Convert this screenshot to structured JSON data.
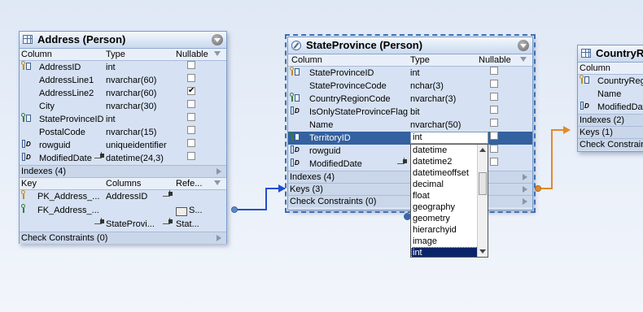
{
  "address": {
    "title": "Address (Person)",
    "headers": {
      "column": "Column",
      "type": "Type",
      "nullable": "Nullable"
    },
    "columns": [
      {
        "name": "AddressID",
        "type": "int",
        "key": "pk",
        "nullable": false
      },
      {
        "name": "AddressLine1",
        "type": "nvarchar(60)",
        "key": "",
        "nullable": false
      },
      {
        "name": "AddressLine2",
        "type": "nvarchar(60)",
        "key": "",
        "nullable": true
      },
      {
        "name": "City",
        "type": "nvarchar(30)",
        "key": "",
        "nullable": false
      },
      {
        "name": "StateProvinceID",
        "type": "int",
        "key": "fk",
        "nullable": false
      },
      {
        "name": "PostalCode",
        "type": "nvarchar(15)",
        "key": "",
        "nullable": false
      },
      {
        "name": "rowguid",
        "type": "uniqueidentifier",
        "key": "d",
        "nullable": false
      },
      {
        "name": "ModifiedDate",
        "type": "datetime(24,3)",
        "key": "d",
        "nullable": false
      }
    ],
    "indexes": "Indexes (4)",
    "key_headers": {
      "key": "Key",
      "columns": "Columns",
      "references": "Refe..."
    },
    "keys": [
      {
        "name": "PK_Address_...",
        "columns": "AddressID",
        "ref": ""
      },
      {
        "name": "FK_Address_...",
        "columns": "",
        "ref": "S..."
      },
      {
        "name": "",
        "columns": "StateProvi...",
        "ref": "Stat..."
      }
    ],
    "check": "Check Constraints (0)"
  },
  "stateprovince": {
    "title": "StateProvince (Person)",
    "headers": {
      "column": "Column",
      "type": "Type",
      "nullable": "Nullable"
    },
    "columns": [
      {
        "name": "StateProvinceID",
        "type": "int",
        "nullable": false
      },
      {
        "name": "StateProvinceCode",
        "type": "nchar(3)",
        "nullable": false
      },
      {
        "name": "CountryRegionCode",
        "type": "nvarchar(3)",
        "nullable": false
      },
      {
        "name": "IsOnlyStateProvinceFlag",
        "type": "bit",
        "nullable": false
      },
      {
        "name": "Name",
        "type": "nvarchar(50)",
        "nullable": false
      },
      {
        "name": "TerritoryID",
        "type": "int",
        "nullable": false
      },
      {
        "name": "rowguid",
        "type": "",
        "nullable": false
      },
      {
        "name": "ModifiedDate",
        "type": "",
        "nullable": false
      }
    ],
    "indexes": "Indexes (4)",
    "keys": "Keys (3)",
    "check": "Check Constraints (0)"
  },
  "type_dropdown": {
    "current": "int",
    "options": [
      "datetime",
      "datetime2",
      "datetimeoffset",
      "decimal",
      "float",
      "geography",
      "geometry",
      "hierarchyid",
      "image",
      "int"
    ],
    "selected": "int"
  },
  "countryregion": {
    "title": "CountryR",
    "header_column": "Column",
    "columns": [
      "CountryReg",
      "Name",
      "ModifiedDat"
    ],
    "indexes": "Indexes (2)",
    "keys": "Keys (1)",
    "check": "Check Constrain"
  },
  "colors": {
    "connector_blue": "#1f4fd0",
    "connector_orange": "#e08a2a",
    "selection": "#34619f"
  }
}
